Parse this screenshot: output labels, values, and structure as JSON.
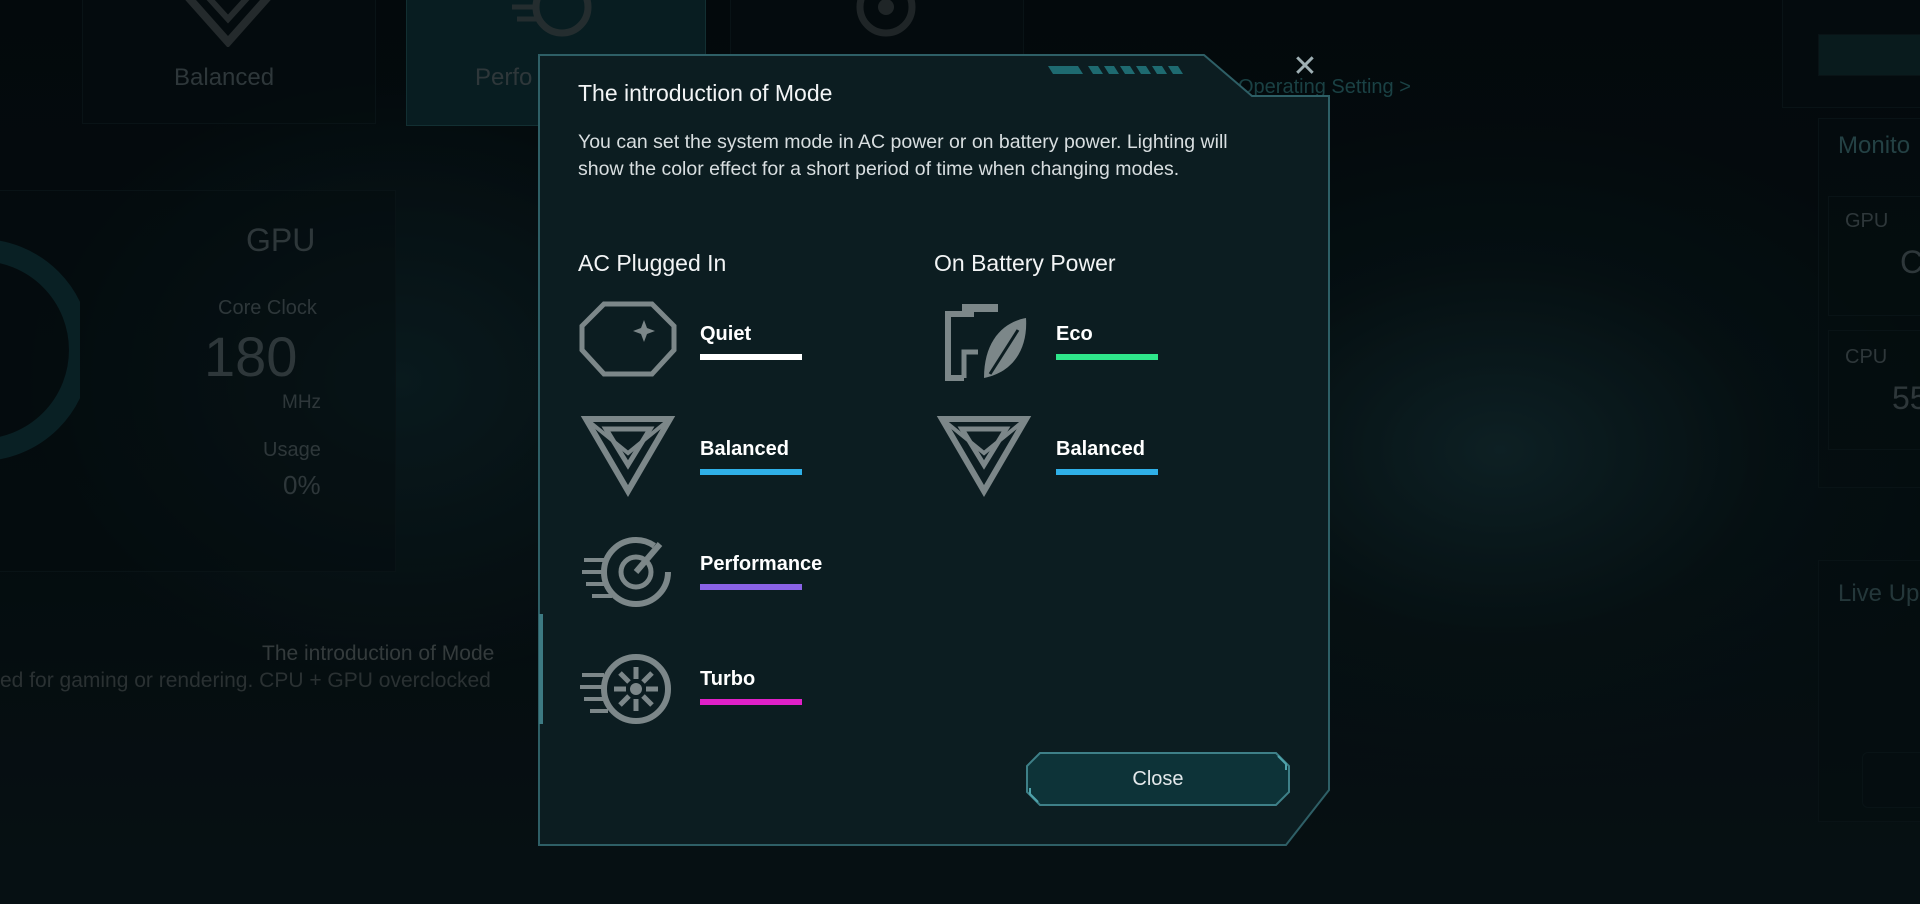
{
  "background": {
    "mode_cards": [
      {
        "label": "Balanced",
        "icon": "balanced-icon"
      },
      {
        "label": "Perfo",
        "icon": "performance-icon",
        "selected": true
      },
      {
        "label": "",
        "icon": "turbo-icon"
      }
    ],
    "gpu_panel": {
      "title": "GPU",
      "core_clock_label": "Core Clock",
      "core_clock_value": "180",
      "core_clock_unit": "MHz",
      "usage_label": "Usage",
      "usage_value": "0%"
    },
    "mode_description_title": "The introduction of Mode",
    "mode_description_text": "ed for gaming or rendering. CPU + GPU overclocked",
    "operating_setting_link": "Operating Setting >",
    "monitor_panel": {
      "title": "Monito",
      "gpu_label": "GPU",
      "gpu_value": "C",
      "cpu_label": "CPU",
      "cpu_value": "55"
    },
    "live_update_label": "Live Up"
  },
  "modal": {
    "title": "The introduction of Mode",
    "description": "You can set the system mode in AC power or on battery power. Lighting will show the color effect for a short period of time when changing modes.",
    "ac_heading": "AC Plugged In",
    "battery_heading": "On Battery Power",
    "ac_modes": [
      {
        "label": "Quiet",
        "color": "#ffffff",
        "icon": "quiet-moon-icon"
      },
      {
        "label": "Balanced",
        "color": "#2fb0e8",
        "icon": "balanced-icon"
      },
      {
        "label": "Performance",
        "color": "#8a63e6",
        "icon": "performance-speedometer-icon"
      },
      {
        "label": "Turbo",
        "color": "#e020c8",
        "icon": "turbo-fan-icon"
      }
    ],
    "battery_modes": [
      {
        "label": "Eco",
        "color": "#2ee68a",
        "icon": "eco-battery-leaf-icon"
      },
      {
        "label": "Balanced",
        "color": "#2fb0e8",
        "icon": "balanced-icon"
      }
    ],
    "close_button_label": "Close",
    "close_icon": "close-icon"
  }
}
